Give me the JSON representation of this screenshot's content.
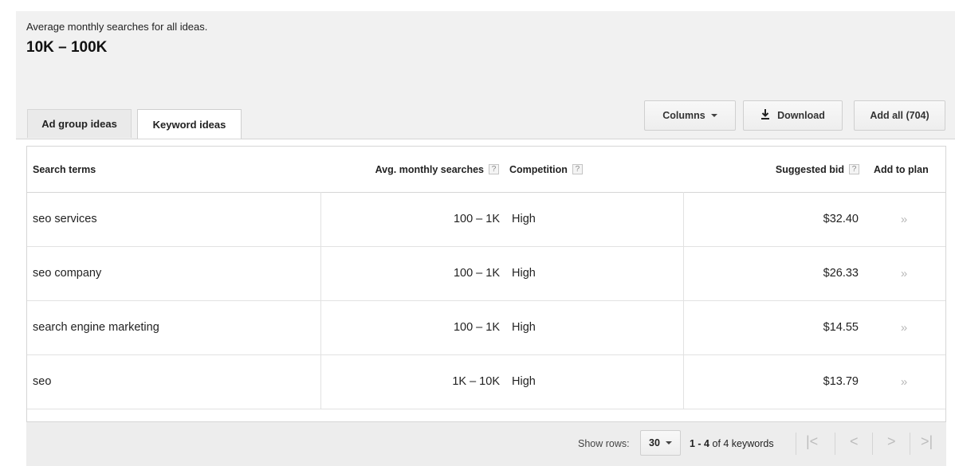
{
  "summary": {
    "label": "Average monthly searches for all ideas.",
    "value": "10K – 100K"
  },
  "tabs": [
    {
      "label": "Ad group ideas",
      "active": false
    },
    {
      "label": "Keyword ideas",
      "active": true
    }
  ],
  "toolbar": {
    "columns_label": "Columns",
    "download_label": "Download",
    "add_all_label": "Add all (704)"
  },
  "table": {
    "headers": {
      "term": "Search terms",
      "avg": "Avg. monthly searches",
      "competition": "Competition",
      "bid": "Suggested bid",
      "add": "Add to plan"
    },
    "help_glyph": "?",
    "add_glyph": "»",
    "rows": [
      {
        "term": "seo services",
        "avg": "100 – 1K",
        "competition": "High",
        "bid": "$32.40"
      },
      {
        "term": "seo company",
        "avg": "100 – 1K",
        "competition": "High",
        "bid": "$26.33"
      },
      {
        "term": "search engine marketing",
        "avg": "100 – 1K",
        "competition": "High",
        "bid": "$14.55"
      },
      {
        "term": "seo",
        "avg": "1K – 10K",
        "competition": "High",
        "bid": "$13.79"
      }
    ]
  },
  "footer": {
    "show_rows_label": "Show rows:",
    "rows_value": "30",
    "range_bold": "1 - 4",
    "range_rest": " of 4 keywords",
    "first_glyph": "|<",
    "prev_glyph": "<",
    "next_glyph": ">",
    "last_glyph": ">|"
  }
}
